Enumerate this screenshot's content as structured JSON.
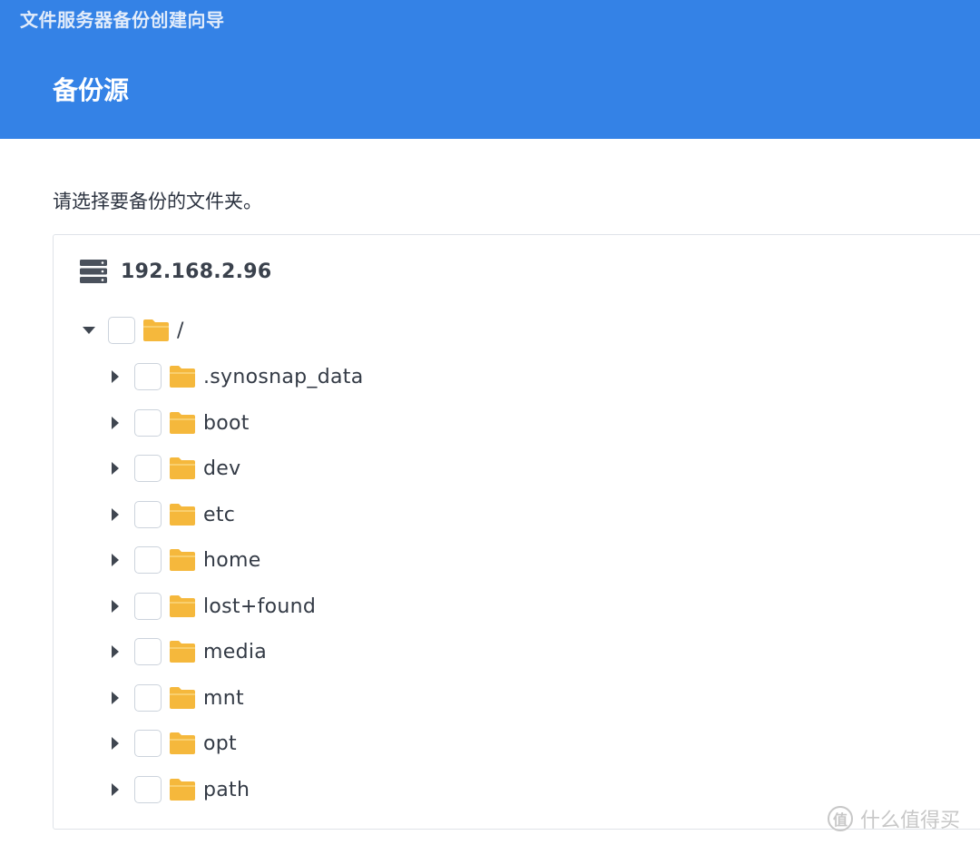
{
  "header": {
    "window_title": "文件服务器备份创建向导",
    "step_title": "备份源"
  },
  "instruction": "请选择要备份的文件夹。",
  "tree": {
    "server_label": "192.168.2.96",
    "root": {
      "label": "/",
      "expanded": true
    },
    "children": [
      {
        "label": ".synosnap_data"
      },
      {
        "label": "boot"
      },
      {
        "label": "dev"
      },
      {
        "label": "etc"
      },
      {
        "label": "home"
      },
      {
        "label": "lost+found"
      },
      {
        "label": "media"
      },
      {
        "label": "mnt"
      },
      {
        "label": "opt"
      },
      {
        "label": "path"
      }
    ]
  },
  "watermark": {
    "badge": "值",
    "text": "什么值得买"
  },
  "colors": {
    "header_bg": "#3482e6",
    "folder": "#f5b83c",
    "checkbox_border": "#ccd3dc"
  }
}
